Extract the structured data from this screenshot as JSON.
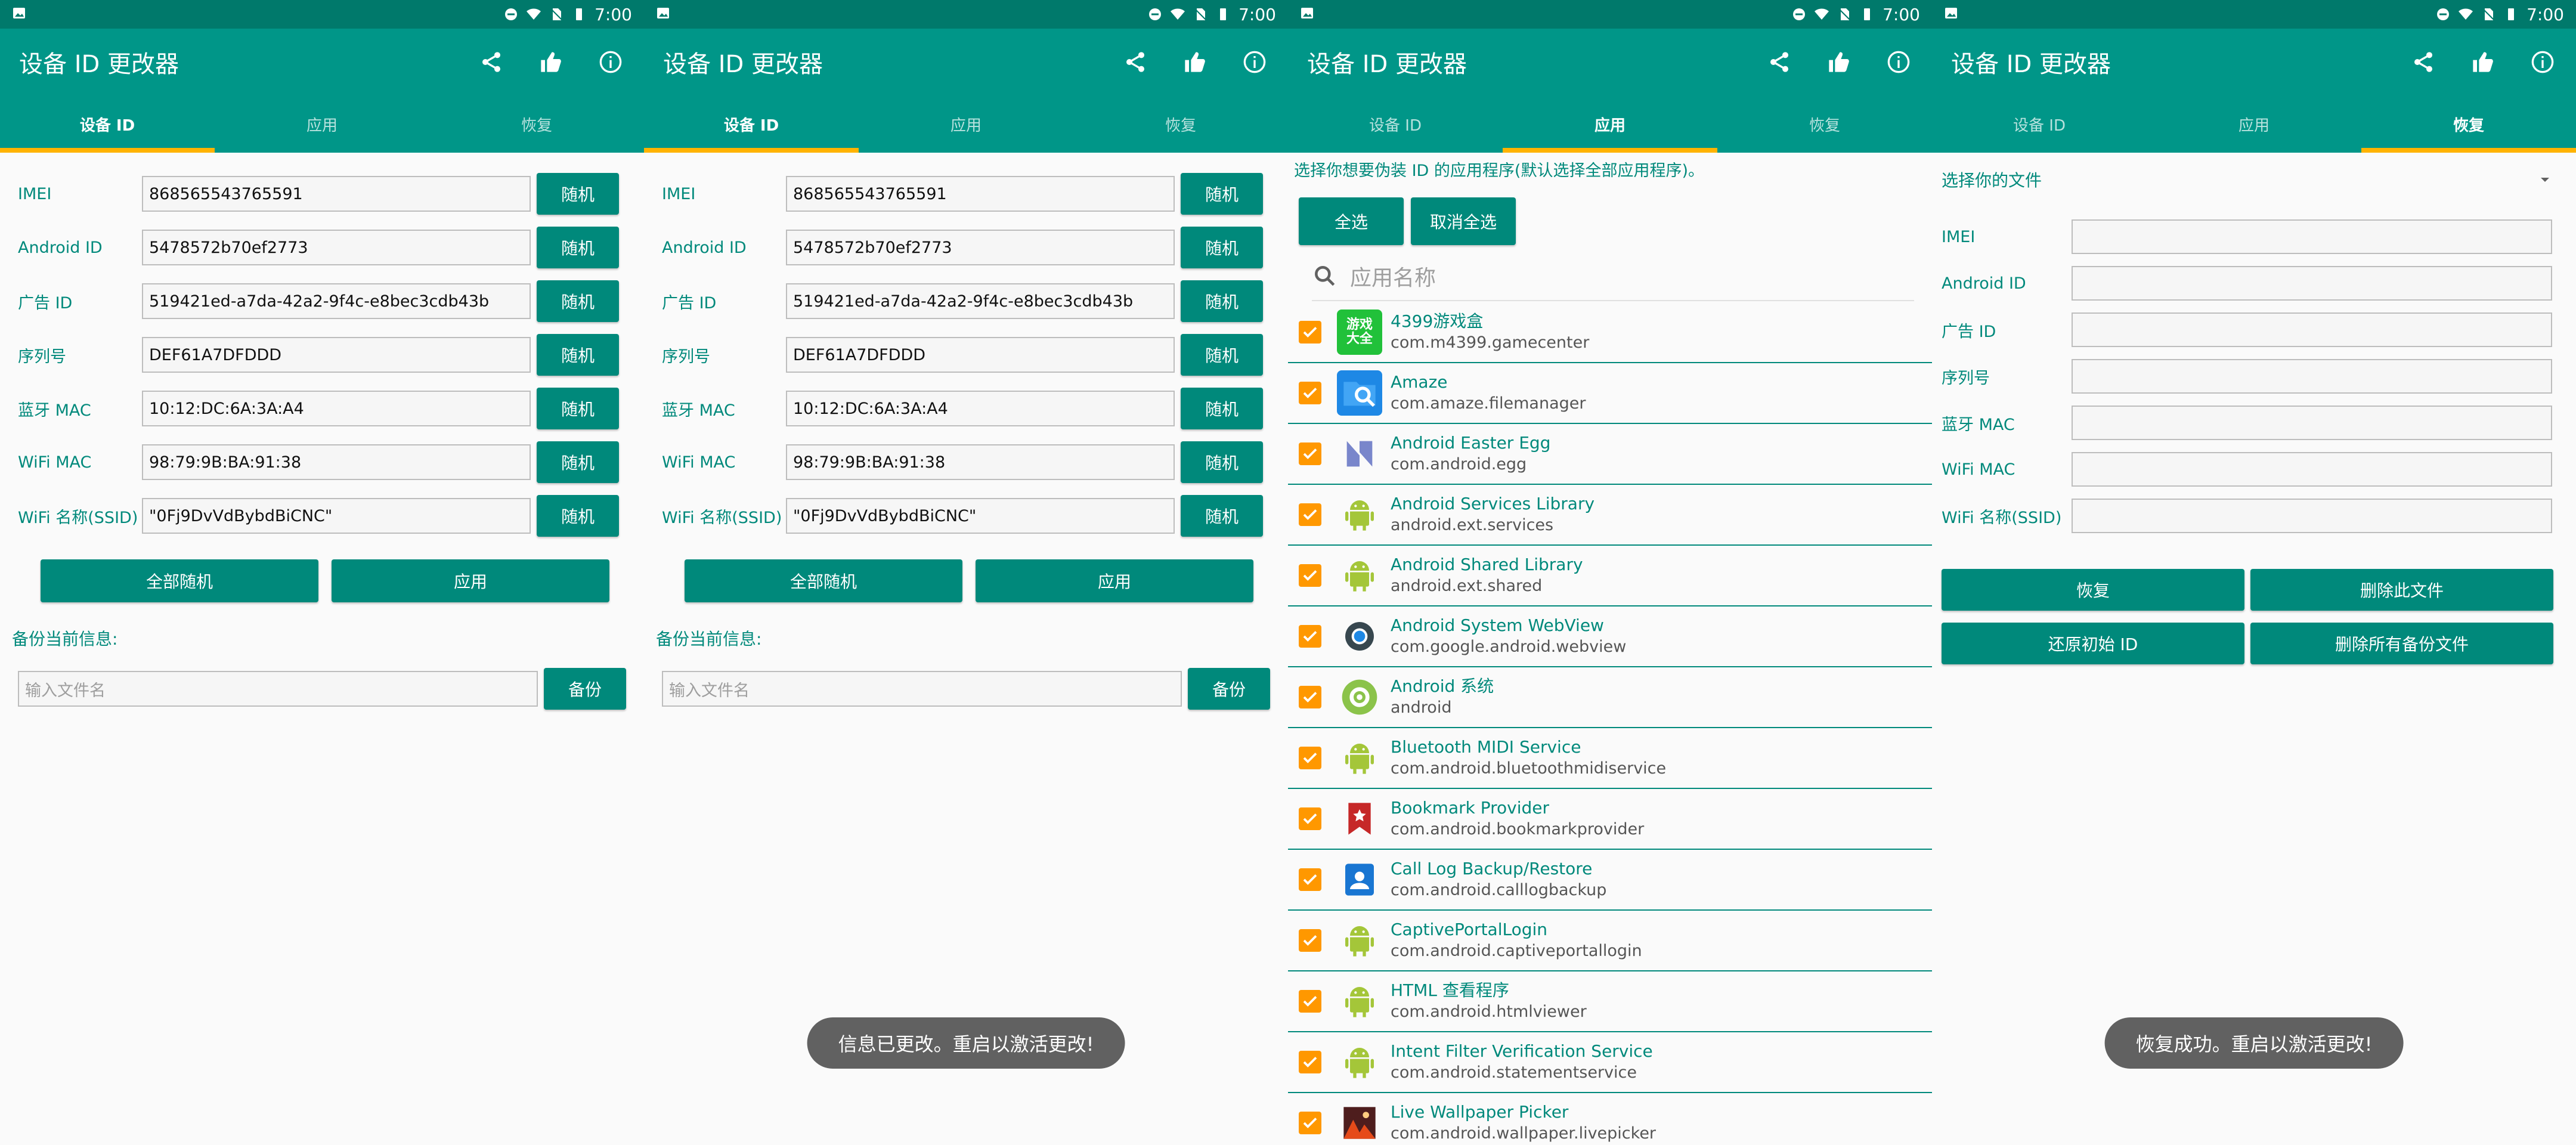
{
  "status_bar": {
    "time": "7:00"
  },
  "app": {
    "title": "设备 ID 更改器"
  },
  "tabs": [
    "设备 ID",
    "应用",
    "恢复"
  ],
  "device_form": {
    "rows": [
      {
        "label": "IMEI",
        "value": "868565543765591"
      },
      {
        "label": "Android ID",
        "value": "5478572b70ef2773"
      },
      {
        "label": "广告 ID",
        "value": "519421ed-a7da-42a2-9f4c-e8bec3cdb43b"
      },
      {
        "label": "序列号",
        "value": "DEF61A7DFDDD"
      },
      {
        "label": "蓝牙 MAC",
        "value": "10:12:DC:6A:3A:A4"
      },
      {
        "label": "WiFi MAC",
        "value": "98:79:9B:BA:91:38"
      },
      {
        "label": "WiFi 名称(SSID)",
        "value": "\"0Fj9DvVdBybdBiCNC\""
      }
    ],
    "random_label": "随机",
    "all_random_label": "全部随机",
    "apply_label": "应用",
    "backup_title": "备份当前信息:",
    "backup_placeholder": "输入文件名",
    "backup_button": "备份"
  },
  "toast_changed": "信息已更改。重启以激活更改!",
  "apps_screen": {
    "hint": "选择你想要伪装 ID 的应用程序(默认选择全部应用程序)。",
    "select_all": "全选",
    "deselect_all": "取消全选",
    "search_placeholder": "应用名称",
    "apps": [
      {
        "name": "4399游戏盒",
        "pkg": "com.m4399.gamecenter",
        "icon": "gamebox-icon",
        "color": "#21c13a"
      },
      {
        "name": "Amaze",
        "pkg": "com.amaze.filemanager",
        "icon": "amaze-icon",
        "color": "#1e88e5"
      },
      {
        "name": "Android Easter Egg",
        "pkg": "com.android.egg",
        "icon": "easter-egg-icon",
        "color": "#5c6bc0"
      },
      {
        "name": "Android Services Library",
        "pkg": "android.ext.services",
        "icon": "android-icon",
        "color": "#8bc34a"
      },
      {
        "name": "Android Shared Library",
        "pkg": "android.ext.shared",
        "icon": "android-icon",
        "color": "#8bc34a"
      },
      {
        "name": "Android System WebView",
        "pkg": "com.google.android.webview",
        "icon": "webview-icon",
        "color": "#455a64"
      },
      {
        "name": "Android 系统",
        "pkg": "android",
        "icon": "android-system-icon",
        "color": "#8bc34a"
      },
      {
        "name": "Bluetooth MIDI Service",
        "pkg": "com.android.bluetoothmidiservice",
        "icon": "android-icon",
        "color": "#8bc34a"
      },
      {
        "name": "Bookmark Provider",
        "pkg": "com.android.bookmarkprovider",
        "icon": "bookmark-icon",
        "color": "#c62828"
      },
      {
        "name": "Call Log Backup/Restore",
        "pkg": "com.android.calllogbackup",
        "icon": "contact-icon",
        "color": "#1976d2"
      },
      {
        "name": "CaptivePortalLogin",
        "pkg": "com.android.captiveportallogin",
        "icon": "android-icon",
        "color": "#8bc34a"
      },
      {
        "name": "HTML 查看程序",
        "pkg": "com.android.htmlviewer",
        "icon": "android-icon",
        "color": "#8bc34a"
      },
      {
        "name": "Intent Filter Verification Service",
        "pkg": "com.android.statementservice",
        "icon": "android-icon",
        "color": "#8bc34a"
      },
      {
        "name": "Live Wallpaper Picker",
        "pkg": "com.android.wallpaper.livepicker",
        "icon": "wallpaper-icon",
        "color": "#6d2c1e"
      }
    ]
  },
  "restore_screen": {
    "file_select": "选择你的文件",
    "labels": [
      "IMEI",
      "Android ID",
      "广告 ID",
      "序列号",
      "蓝牙 MAC",
      "WiFi MAC",
      "WiFi 名称(SSID)"
    ],
    "buttons": [
      "恢复",
      "删除此文件",
      "还原初始 ID",
      "删除所有备份文件"
    ]
  },
  "toast_restored": "恢复成功。重启以激活更改!",
  "colors": {
    "primary": "#009688",
    "primary_dark": "#00796b",
    "accent": "#ffb300",
    "checkbox": "#ff9800"
  }
}
